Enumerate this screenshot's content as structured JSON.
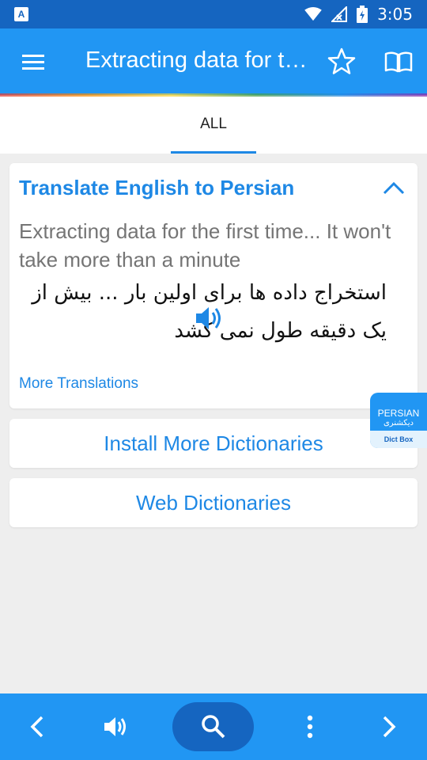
{
  "status_bar": {
    "app_badge": "A",
    "time": "3:05"
  },
  "toolbar": {
    "title": "Extracting data for the first time... It won't take more than a minute"
  },
  "tabs": [
    {
      "label": "ALL",
      "selected": true
    }
  ],
  "translation_card": {
    "title": "Translate English to Persian",
    "source_text": "Extracting data for the first time... It won't take more than a minute",
    "translated_text": "استخراج داده ها برای اولین بار ... بیش از یک دقیقه طول نمی کشد",
    "more_link": "More Translations"
  },
  "buttons": {
    "install_more": "Install More Dictionaries",
    "web_dictionaries": "Web Dictionaries"
  },
  "persian_badge": {
    "label": "PERSIAN",
    "label_fa": "دیکشنری",
    "footer": "Dict Box"
  },
  "icons": {
    "menu": "menu-icon",
    "star": "star-icon",
    "book": "book-icon",
    "collapse": "chevron-up-icon",
    "speaker": "speaker-icon",
    "back": "chevron-left-icon",
    "volume": "volume-icon",
    "search": "search-icon",
    "more": "more-vertical-icon",
    "forward": "chevron-right-icon"
  },
  "colors": {
    "primary": "#2196f3",
    "primary_dark": "#1565c0",
    "accent_text": "#1e88e5",
    "background": "#eeeeee"
  }
}
